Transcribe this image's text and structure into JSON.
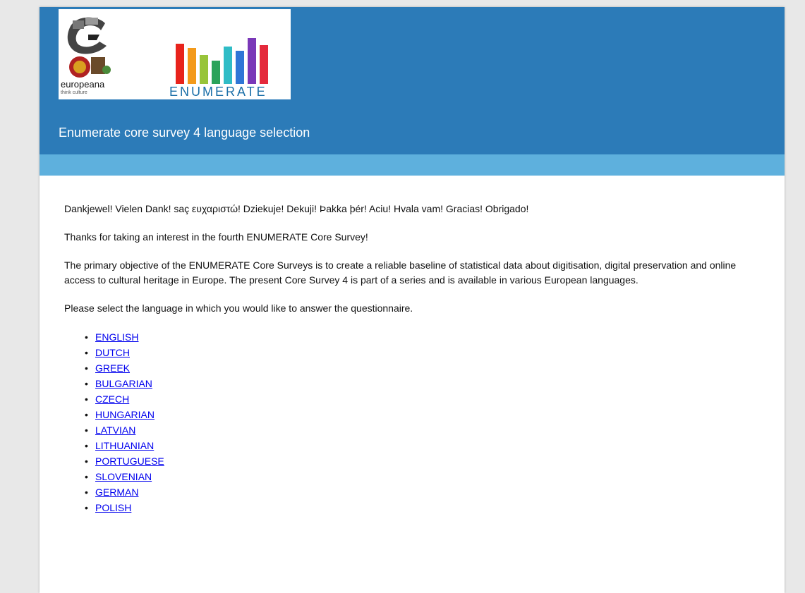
{
  "header": {
    "logo_europeana": "europeana",
    "logo_europeana_tagline": "think culture",
    "logo_enumerate": "ENUMERATE",
    "title": "Enumerate core survey 4 language selection",
    "colors": {
      "header_bg": "#2c7bb8",
      "subband_bg": "#5eb0dd"
    }
  },
  "main": {
    "thanks_multilingual": "Dankjewel! Vielen Dank! saç ευχαριστώ! Dziekuje! Dekuji! Þakka þér! Aciu! Hvala vam! Gracias! Obrigado!",
    "thanks_intro": "Thanks for taking an interest in the fourth ENUMERATE Core Survey!",
    "objective": "The primary objective of the ENUMERATE Core Surveys is to create a reliable baseline of statistical data about digitisation, digital preservation and online access to cultural heritage in Europe. The present Core Survey 4 is part of a series and is available in various European languages.",
    "instruction": "Please select the language in which you would like to answer the questionnaire.",
    "languages": [
      "ENGLISH",
      "DUTCH",
      "GREEK",
      "BULGARIAN",
      "CZECH",
      "HUNGARIAN",
      "LATVIAN",
      "LITHUANIAN",
      "PORTUGUESE",
      "SLOVENIAN",
      "GERMAN",
      "POLISH"
    ]
  }
}
